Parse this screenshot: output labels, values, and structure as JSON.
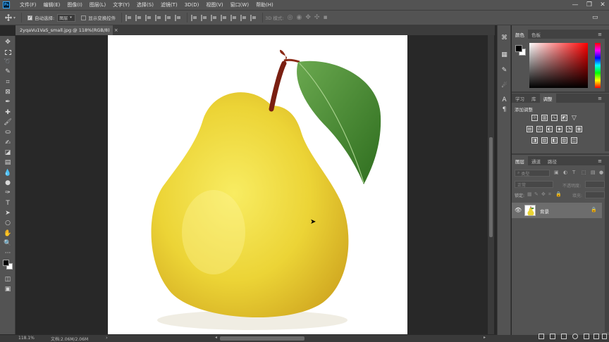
{
  "menubar": {
    "logo": "Ps",
    "items": [
      "文件(F)",
      "编辑(E)",
      "图像(I)",
      "图层(L)",
      "文字(Y)",
      "选择(S)",
      "滤镜(T)",
      "3D(D)",
      "视图(V)",
      "窗口(W)",
      "帮助(H)"
    ],
    "window_controls": [
      "—",
      "❐",
      "✕"
    ]
  },
  "options_bar": {
    "auto_select_label": "自动选择:",
    "auto_select_checked": true,
    "auto_select_value": "图层",
    "show_transform_label": "显示变换控件",
    "show_transform_checked": false,
    "mode_3d_label": "3D 模式:"
  },
  "document": {
    "tab_title": "2yqaVu1VaS_small.jpg @ 118%(RGB/8)",
    "close_glyph": "×"
  },
  "status": {
    "zoom": "118.1%",
    "doc_size": "文档:2.06M/2.06M"
  },
  "color_panel": {
    "tabs": [
      "颜色",
      "色板"
    ],
    "foreground": "#000000",
    "background": "#ffffff"
  },
  "adjust_panel": {
    "tabs": [
      "学习",
      "库",
      "调整"
    ],
    "title": "添加调整"
  },
  "layers_panel": {
    "tabs": [
      "图层",
      "通道",
      "路径"
    ],
    "search_placeholder": "类型",
    "blend_mode": "正常",
    "opacity_label": "不透明度:",
    "lock_label": "锁定:",
    "fill_label": "填充:",
    "layer_name": "背景"
  },
  "colors": {
    "chrome": "#535353",
    "workspace": "#282828",
    "accent": "#31a8ff"
  }
}
